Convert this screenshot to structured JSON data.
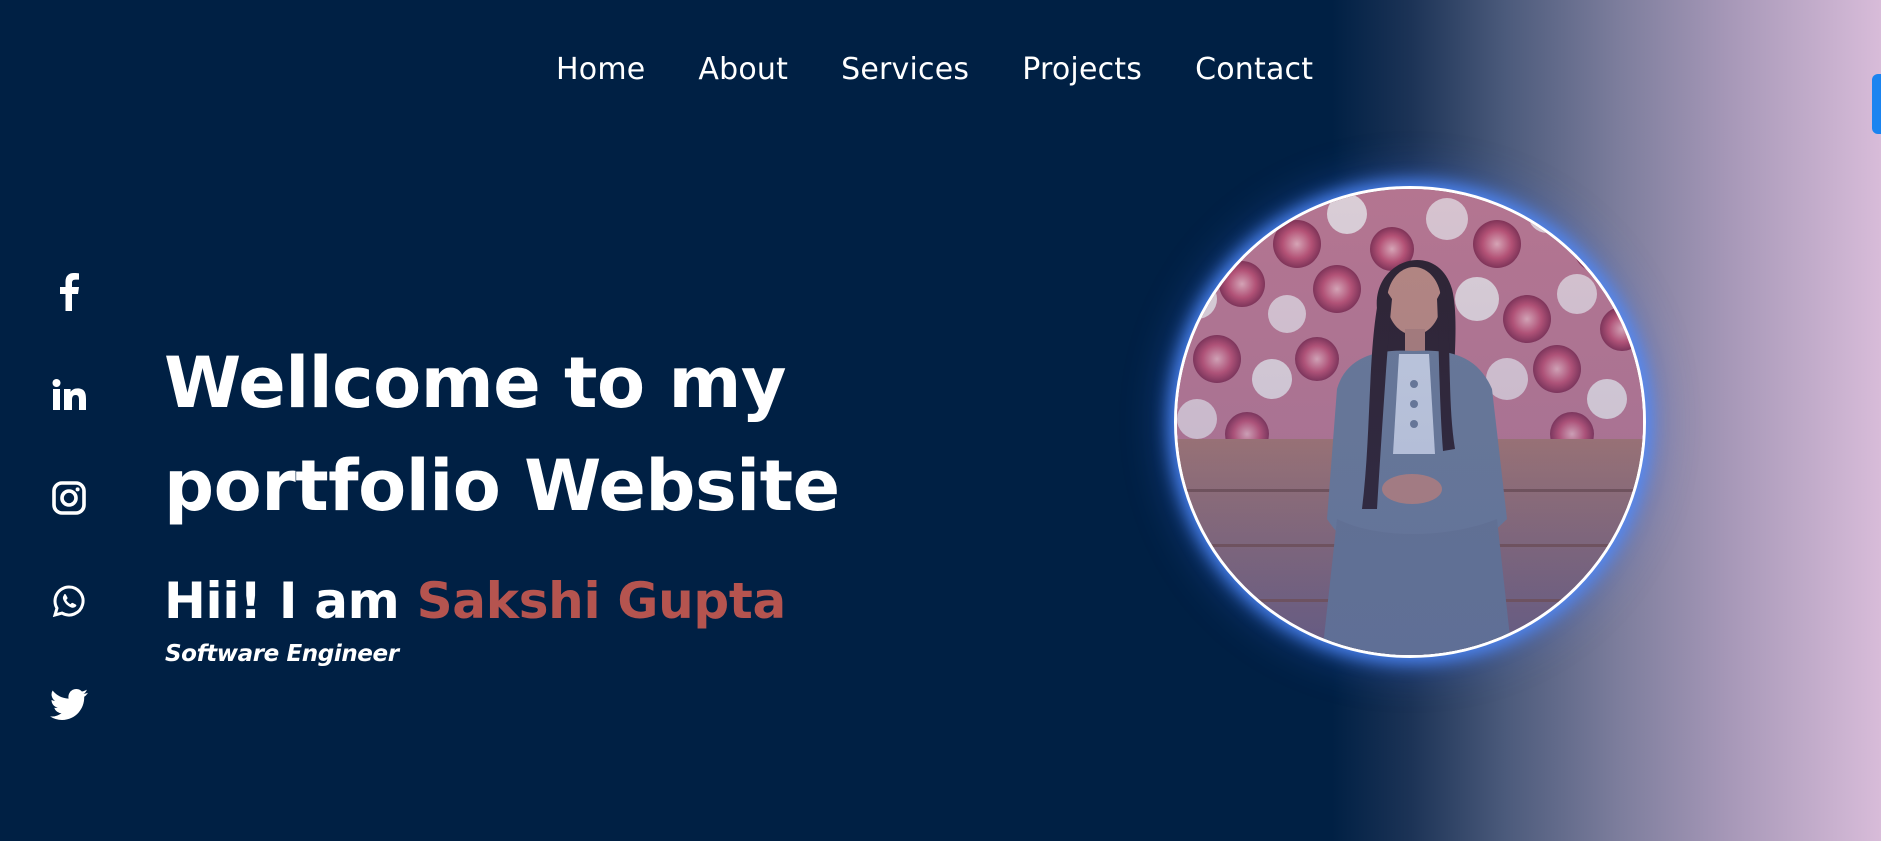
{
  "nav": {
    "items": [
      "Home",
      "About",
      "Services",
      "Projects",
      "Contact"
    ]
  },
  "socials": [
    {
      "icon": "facebook-icon"
    },
    {
      "icon": "linkedin-icon"
    },
    {
      "icon": "instagram-icon"
    },
    {
      "icon": "whatsapp-icon"
    },
    {
      "icon": "twitter-icon"
    }
  ],
  "hero": {
    "title": "Wellcome to my portfolio Website",
    "greeting_prefix": "Hii! I am ",
    "name": "Sakshi Gupta",
    "role": "Software Engineer"
  },
  "colors": {
    "background": "#002044",
    "accent_name": "#b5544f",
    "glow": "#508cff",
    "scrollbar": "#1a84f0"
  }
}
